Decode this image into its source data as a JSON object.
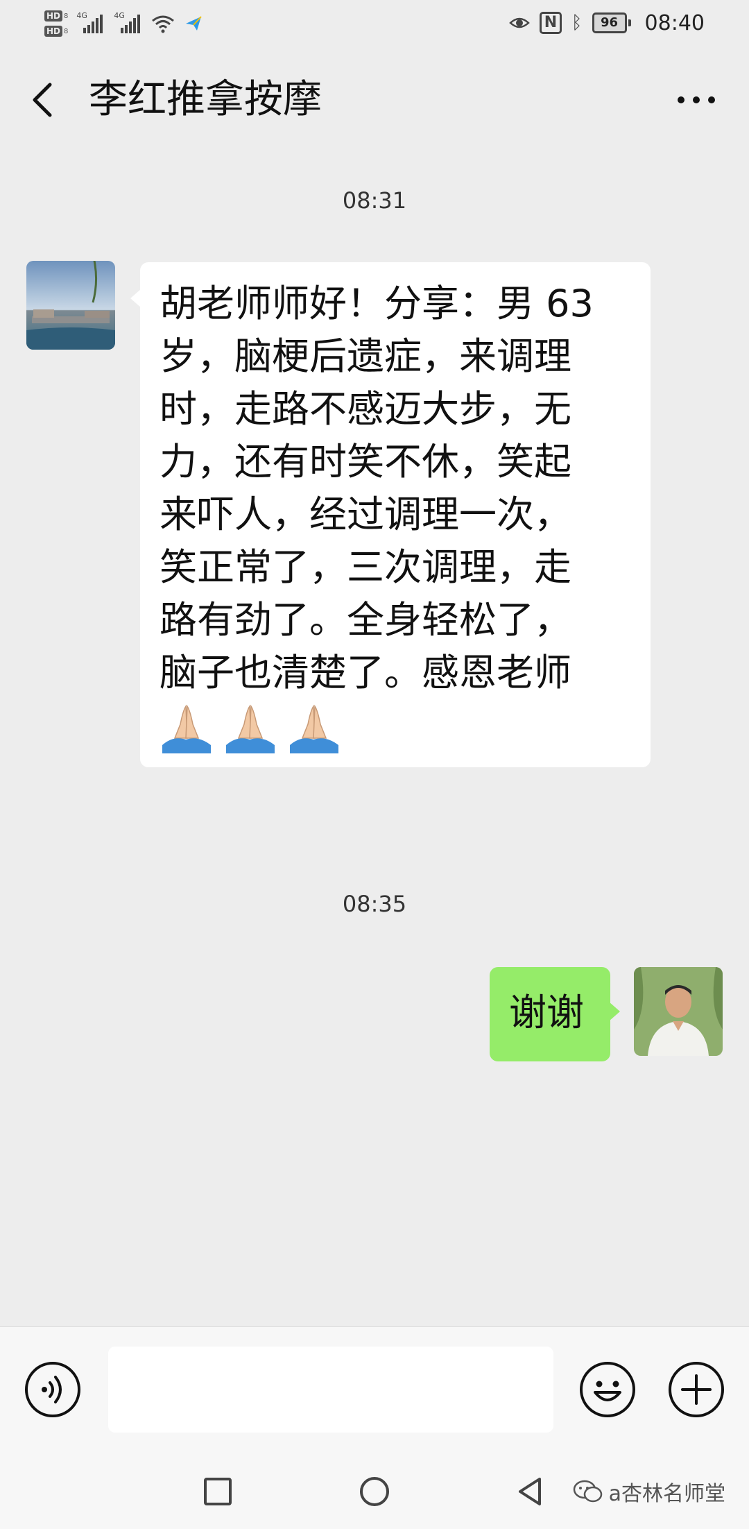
{
  "status_bar": {
    "hd_label": "HD",
    "sim_sub": "8",
    "network1": "4G",
    "network2": "4G",
    "battery": "96",
    "time": "08:40"
  },
  "header": {
    "title": "李红推拿按摩"
  },
  "messages": [
    {
      "timestamp": "08:31",
      "direction": "incoming",
      "text": "胡老师师好！分享：男 63\n岁，脑梗后遗症，来调理\n时，走路不感迈大步，无\n力，还有时笑不休，笑起\n来吓人，经过调理一次，\n笑正常了，三次调理，走\n路有劲了。全身轻松了，\n脑子也清楚了。感恩老师",
      "emoji": [
        "folded-hands",
        "folded-hands",
        "folded-hands"
      ]
    },
    {
      "timestamp": "08:35",
      "direction": "outgoing",
      "text": "谢谢"
    }
  ],
  "input": {
    "value": "",
    "placeholder": ""
  },
  "watermark": {
    "text": "a杏林名师堂"
  },
  "colors": {
    "background": "#ededed",
    "incoming_bubble": "#ffffff",
    "outgoing_bubble": "#95ec69",
    "bar_bg": "#f7f7f7"
  }
}
